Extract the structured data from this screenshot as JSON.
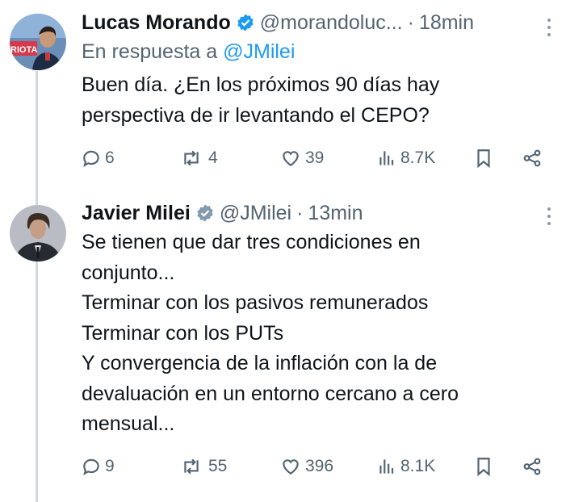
{
  "tweets": [
    {
      "name": "Lucas Morando",
      "handle": "@morandoluc...",
      "time": "18min",
      "reply_prefix": "En respuesta a",
      "reply_mention": "@JMilei",
      "text": "Buen día. ¿En los próximos 90 días hay\nperspectiva de ir levantando el CEPO?",
      "replies": "6",
      "retweets": "4",
      "likes": "39",
      "views": "8.7K",
      "avatar_label": "RIOTA",
      "verified_color": "#1d9bf0"
    },
    {
      "name": "Javier Milei",
      "handle": "@JMilei",
      "time": "13min",
      "text": "Se tienen que dar tres condiciones en\nconjunto...\nTerminar con los pasivos remunerados\nTerminar con los PUTs\nY convergencia de la inflación con la de\ndevaluación en un entorno cercano a cero\nmensual...",
      "replies": "9",
      "retweets": "55",
      "likes": "396",
      "views": "8.1K",
      "verified_color": "#829aab"
    }
  ]
}
